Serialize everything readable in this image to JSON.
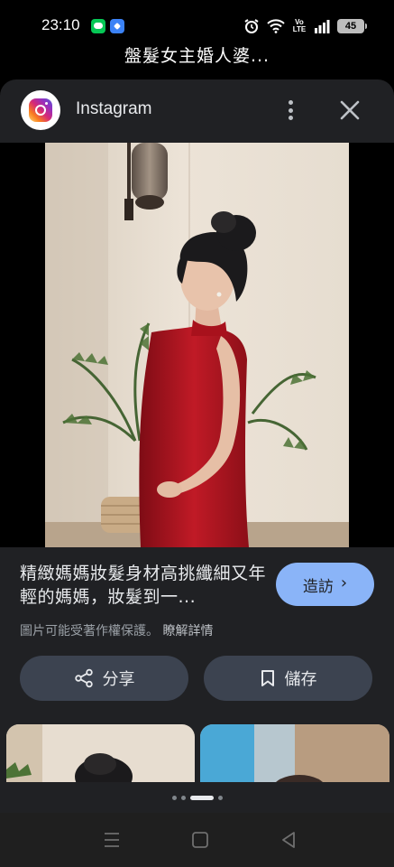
{
  "status_bar": {
    "time": "23:10",
    "network": "Vo LTE",
    "battery": "45",
    "icons": [
      "line-app-icon",
      "blue-app-icon",
      "alarm-icon",
      "wifi-icon",
      "volte-icon",
      "signal-icon",
      "battery-icon"
    ]
  },
  "page": {
    "title": "盤髮女主婚人婆..."
  },
  "source": {
    "name": "Instagram",
    "icon": "instagram-icon"
  },
  "result": {
    "title": "精緻媽媽妝髮身材高挑纖細又年輕的媽媽，妝髮到一...",
    "visit_label": "造訪",
    "copyright_text": "圖片可能受著作權保護。",
    "learn_more": "瞭解詳情"
  },
  "actions": {
    "share_label": "分享",
    "save_label": "儲存"
  },
  "pager": {
    "count": 4,
    "active": 2
  },
  "colors": {
    "sheet_bg": "#202124",
    "accent": "#8ab4f8",
    "button_bg": "#3c4350",
    "dress_red": "#b3121f"
  }
}
